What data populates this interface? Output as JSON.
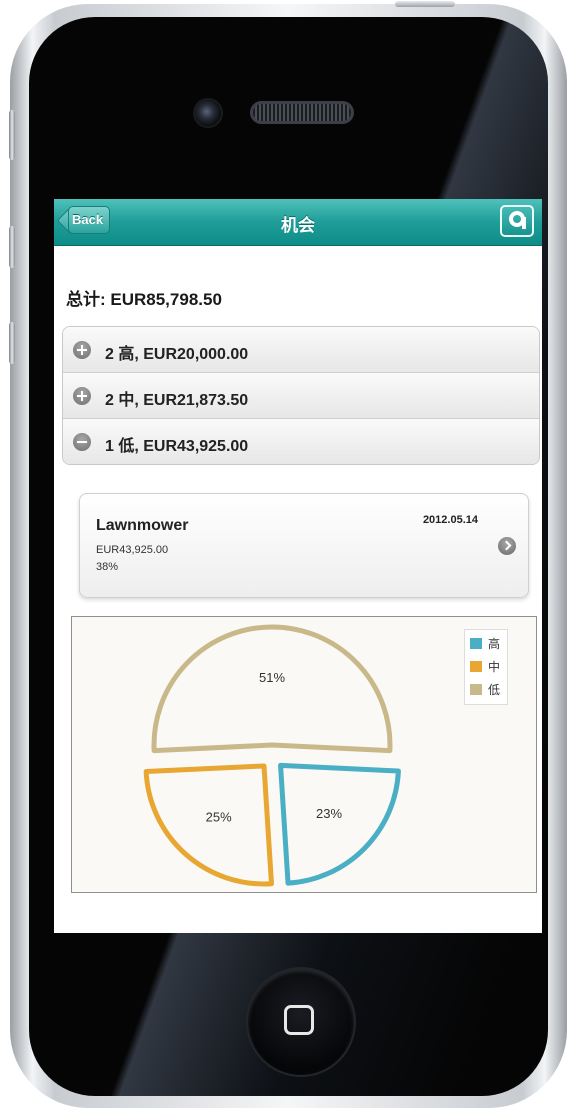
{
  "header": {
    "back_label": "Back",
    "title": "机会"
  },
  "summary": {
    "total": "总计: EUR85,798.50"
  },
  "groups": [
    {
      "label": "2 高, EUR20,000.00",
      "state": "collapsed"
    },
    {
      "label": "2 中, EUR21,873.50",
      "state": "collapsed"
    },
    {
      "label": "1 低, EUR43,925.00",
      "state": "expanded"
    }
  ],
  "opportunity": {
    "name": "Lawnmower",
    "amount": "EUR43,925.00",
    "probability": "38%",
    "date": "2012.05.14"
  },
  "colors": {
    "header": "#1f9d98",
    "high": "#4aaec4",
    "mid": "#e8a632",
    "low": "#c9b98a"
  },
  "chart_data": {
    "type": "pie",
    "categories": [
      "高",
      "中",
      "低"
    ],
    "values": [
      23,
      25,
      51
    ],
    "labels": [
      "23%",
      "25%",
      "51%"
    ],
    "colors": [
      "#4aaec4",
      "#e8a632",
      "#c9b98a"
    ],
    "legend": "top-right"
  }
}
